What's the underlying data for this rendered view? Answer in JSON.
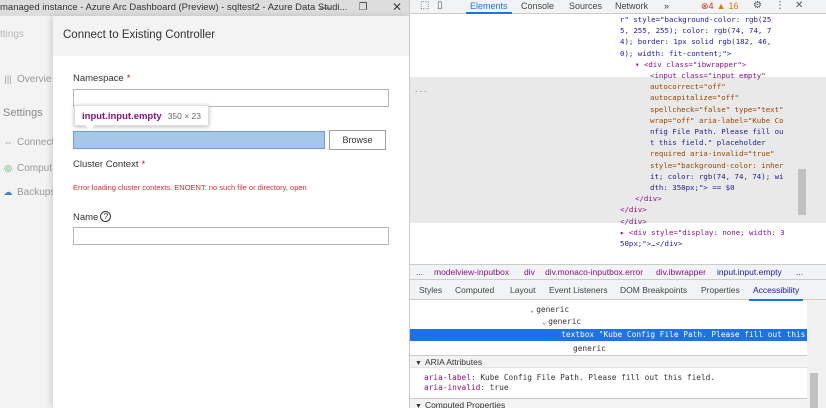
{
  "app": {
    "window_title": "managed instance - Azure Arc Dashboard (Preview) - sqltest2 - Azure Data Studi...",
    "window_controls": {
      "minimize": "—",
      "maximize": "❐",
      "close": "✕"
    },
    "sidebar": {
      "top_label": "ttings",
      "overview_label": "Overvie",
      "settings_heading": "Settings",
      "items": [
        {
          "label": "Connect",
          "icon": "plug-icon"
        },
        {
          "label": "Comput",
          "icon": "compute-icon"
        },
        {
          "label": "Backups",
          "icon": "cloud-icon"
        }
      ]
    },
    "dialog": {
      "title": "Connect to Existing Controller",
      "namespace_label": "Namespace",
      "required_mark": "*",
      "browse_button": "Browse",
      "cluster_context_label": "Cluster Context",
      "error_text": "Error loading cluster contexts. ENOENT: no such file or directory, open",
      "name_label": "Name",
      "help_glyph": "?"
    },
    "inspect_tooltip": {
      "selector": "input.input.empty",
      "size": "350 × 23"
    }
  },
  "devtools": {
    "tabs": [
      "Elements",
      "Console",
      "Sources",
      "Network",
      "»"
    ],
    "active_tab": "Elements",
    "error_count": "4",
    "warning_count": "16",
    "code_lines": [
      {
        "text": "r\" style=\"background-color: rgb(25",
        "indent": 0
      },
      {
        "text": "5, 255, 255); color: rgb(74, 74, 7",
        "indent": 0
      },
      {
        "text": "4); border: 1px solid rgb(182, 46,",
        "indent": 0
      },
      {
        "text": "0); width: fit-content;\">",
        "indent": 0
      },
      {
        "text": "▾ <div class=\"ibwrapper\">",
        "indent": 1
      },
      {
        "text": "<input class=\"input empty\"",
        "indent": 2
      },
      {
        "text": "autocorrect=\"off\"",
        "indent": 2
      },
      {
        "text": "autocapitalize=\"off\"",
        "indent": 2
      },
      {
        "text": "spellcheck=\"false\" type=\"text\"",
        "indent": 2
      },
      {
        "text": "wrap=\"off\" aria-label=\"Kube Co",
        "indent": 2
      },
      {
        "text": "nfig File Path. Please fill ou",
        "indent": 2
      },
      {
        "text": "t this field.\" placeholder",
        "indent": 2
      },
      {
        "text": "required aria-invalid=\"true\"",
        "indent": 2
      },
      {
        "text": "style=\"background-color: inher",
        "indent": 2
      },
      {
        "text": "it; color: rgb(74, 74, 74); wi",
        "indent": 2
      },
      {
        "text": "dth: 350px;\"> == $0",
        "indent": 2
      },
      {
        "text": "</div>",
        "indent": 1
      },
      {
        "text": "</div>",
        "indent": 0
      },
      {
        "text": "</div>",
        "indent": 0
      },
      {
        "text": "▸ <div style=\"display: none; width: 3",
        "indent": 0
      },
      {
        "text": "50px;\">…</div>",
        "indent": 0
      }
    ],
    "breadcrumbs": [
      "...",
      "modelview-inputbox",
      "div",
      "div.monaco-inputbox.error",
      "div.ibwrapper",
      "input.input.empty",
      "..."
    ],
    "subtabs": [
      "Styles",
      "Computed",
      "Layout",
      "Event Listeners",
      "DOM Breakpoints",
      "Properties",
      "Accessibility"
    ],
    "active_subtab": "Accessibility",
    "accessibility_tree": {
      "node1": "generic",
      "node2": "generic",
      "selected": "textbox \"Kube Config File Path. Please fill out this field.\"",
      "node4": "generic"
    },
    "aria_section": "ARIA Attributes",
    "aria_attrs": [
      {
        "key": "aria-label",
        "value": "Kube Config File Path. Please fill out this field."
      },
      {
        "key": "aria-invalid",
        "value": "true"
      }
    ],
    "computed_section": "Computed Properties"
  },
  "colors": {
    "accent": "#1a73e8",
    "error": "#d32f2f",
    "highlight_input": "#a5c8ea"
  }
}
